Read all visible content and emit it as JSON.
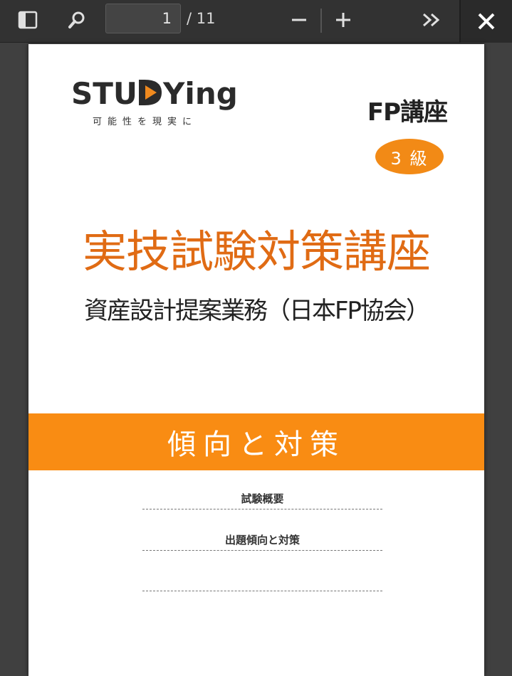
{
  "toolbar": {
    "page_current": "1",
    "page_total": "/ 11",
    "icons": [
      "sidebar-toggle-icon",
      "search-icon",
      "minus-icon",
      "plus-icon",
      "double-chevron-right-icon",
      "close-icon"
    ]
  },
  "document": {
    "logo_text_left": "STU",
    "logo_text_right": "Ying",
    "logo_tagline": "可能性を現実に",
    "course_title": "FP講座",
    "grade": "3 級",
    "main_title": "実技試験対策講座",
    "sub_title": "資産設計提案業務（日本FP協会）",
    "band_text": "傾向と対策",
    "toc": [
      "試験概要",
      "出題傾向と対策"
    ]
  },
  "colors": {
    "accent_orange": "#f98c13",
    "title_orange": "#e06b14",
    "logo_orange": "#f08a1e",
    "toolbar_bg": "#323232"
  }
}
